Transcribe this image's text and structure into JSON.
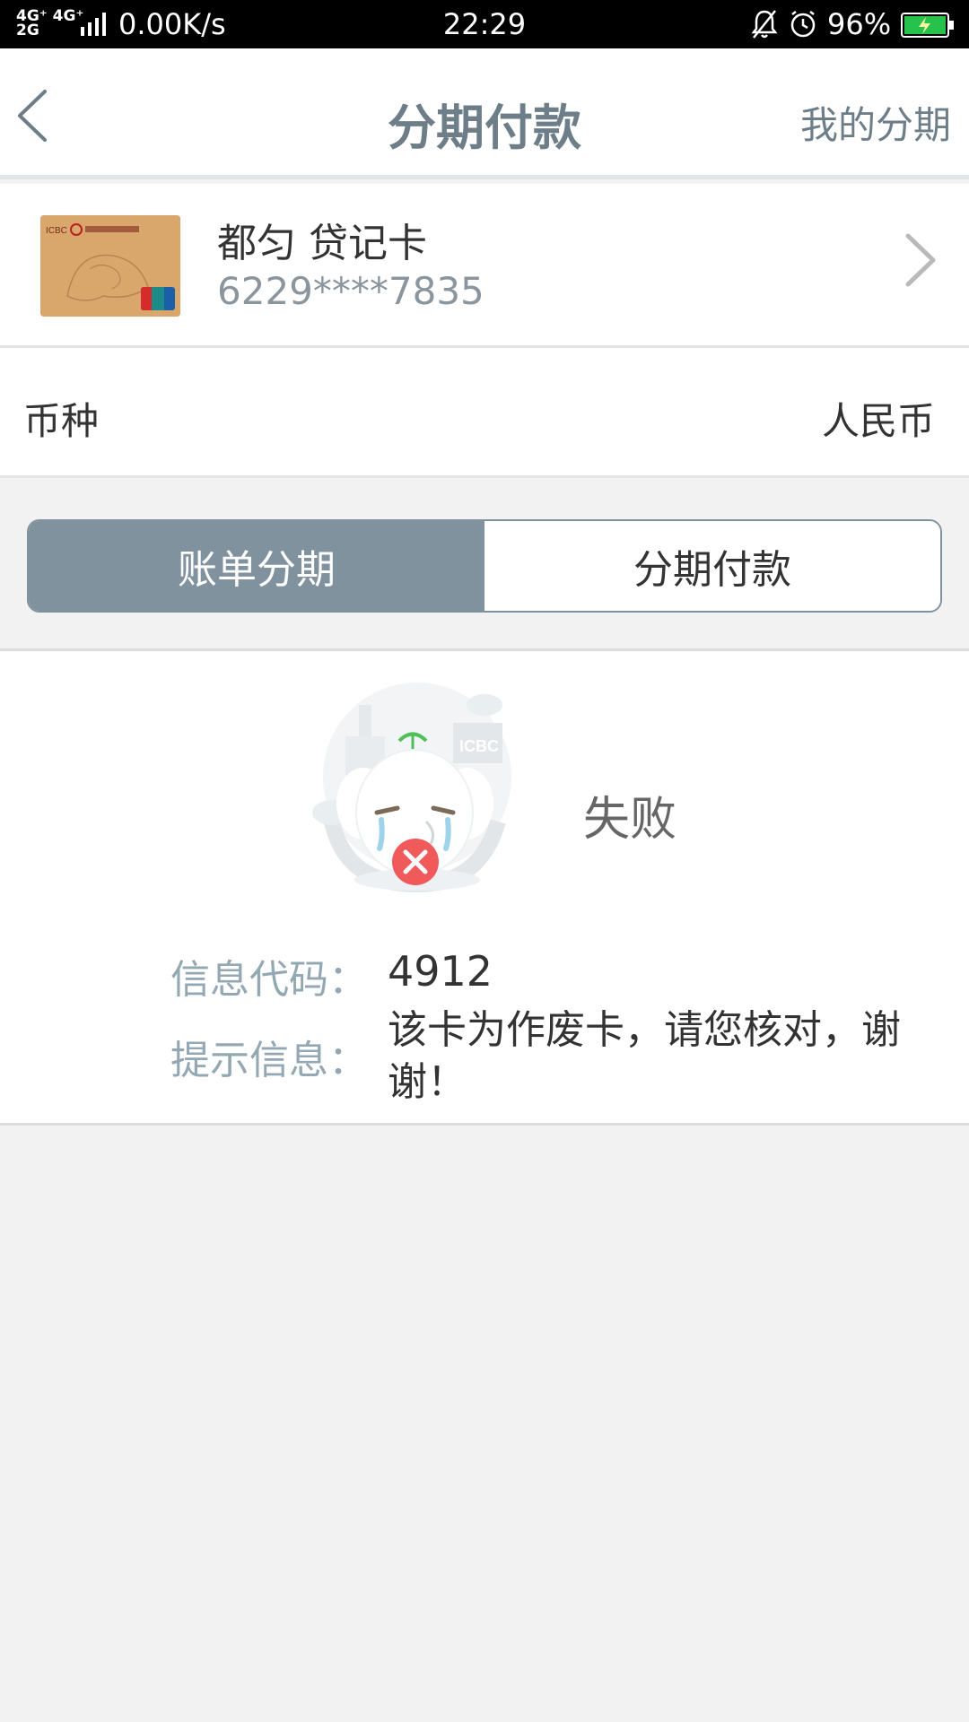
{
  "status_bar": {
    "network": "4G⁺ 4G⁺\n2G",
    "speed": "0.00K/s",
    "time": "22:29",
    "battery_percent": "96%",
    "icons": [
      "signal-icon",
      "bell-muted-icon",
      "alarm-icon",
      "battery-charging-icon"
    ]
  },
  "header": {
    "title": "分期付款",
    "right_link": "我的分期",
    "back_icon": "chevron-left-icon"
  },
  "card": {
    "name": "都匀 贷记卡",
    "number": "6229****7835",
    "chevron_icon": "chevron-right-icon"
  },
  "currency": {
    "label": "币种",
    "value": "人民币"
  },
  "segmented": {
    "tab_bill": "账单分期",
    "tab_installment": "分期付款",
    "active": "tab_bill"
  },
  "result": {
    "status": "失败",
    "code_label": "信息代码：",
    "code_value": "4912",
    "message_label": "提示信息：",
    "message_value": "该卡为作废卡，请您核对，谢谢！",
    "mascot_badge_text": "ICBC"
  },
  "colors": {
    "accent": "#7f929e",
    "header_text": "#6d7e89",
    "label_text": "#93a8b3",
    "error_red": "#f05a5a",
    "battery_green": "#27c24c"
  }
}
